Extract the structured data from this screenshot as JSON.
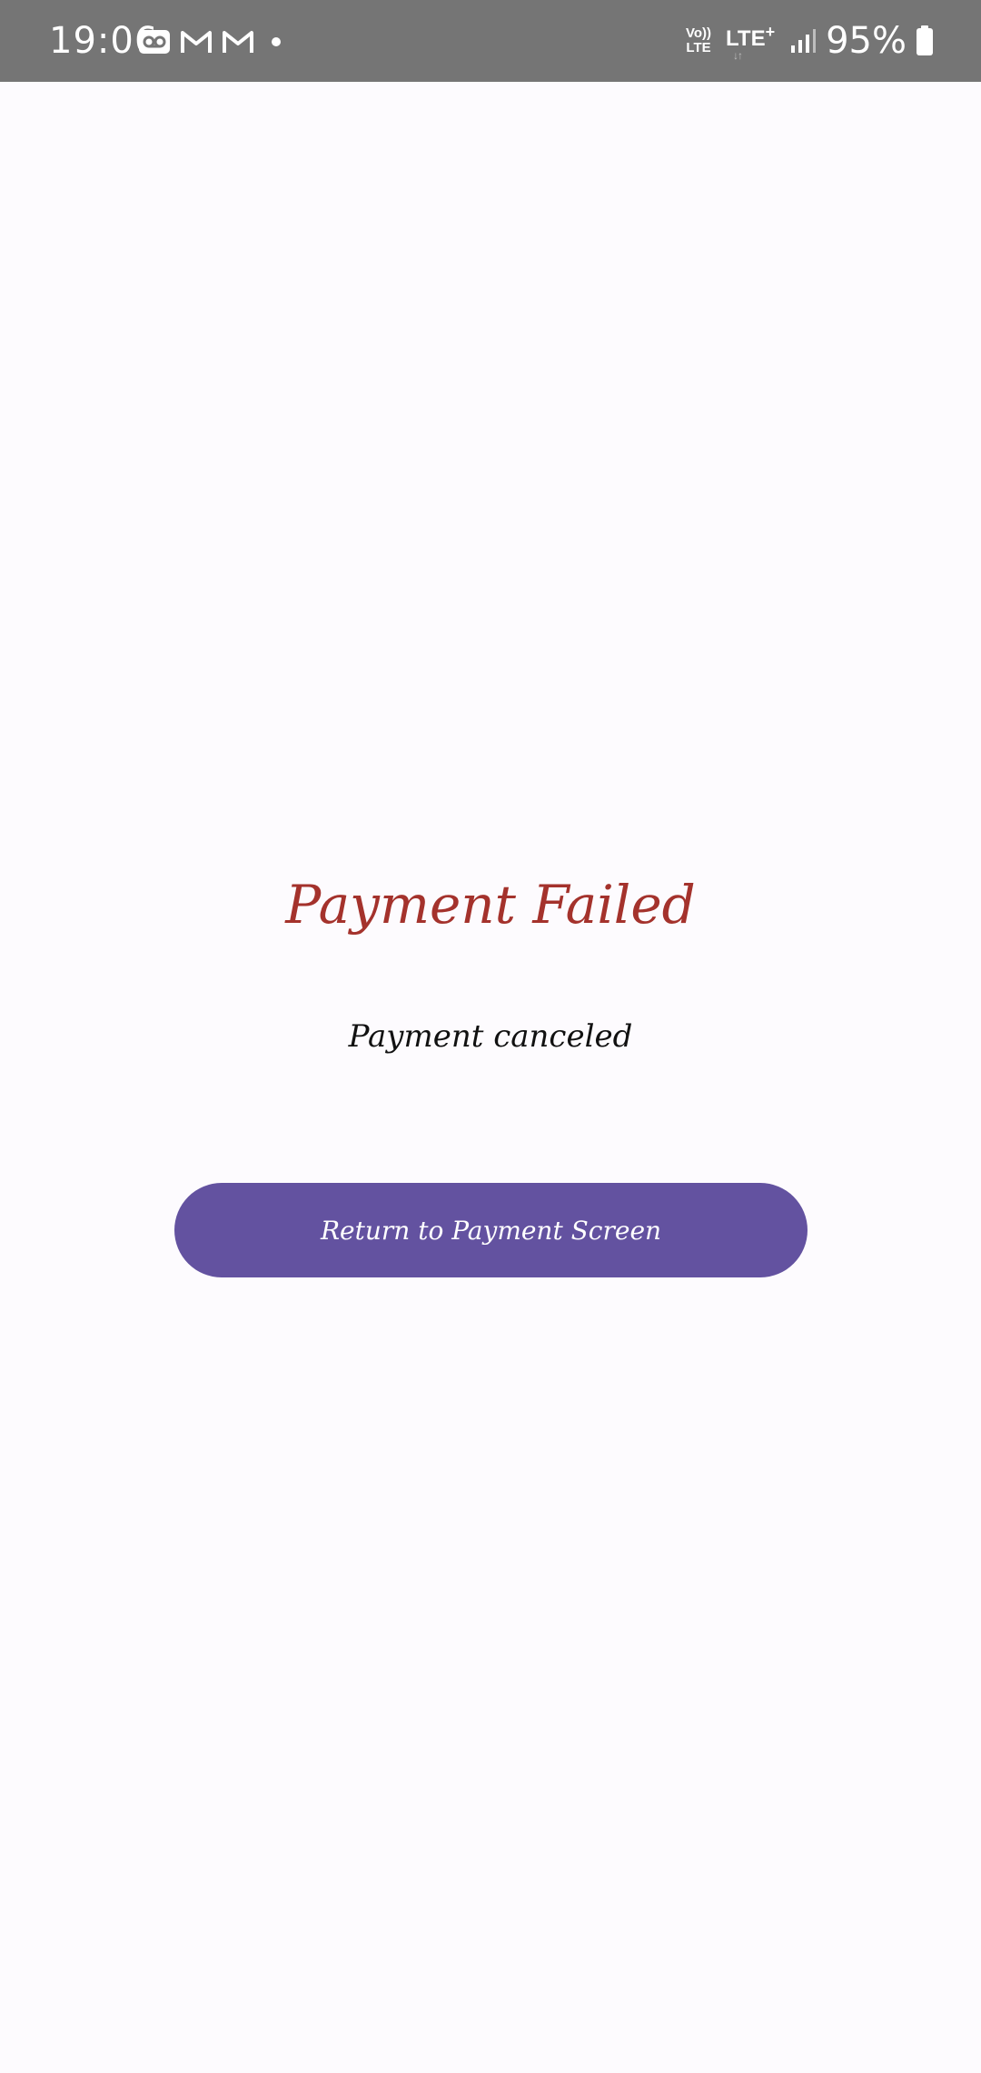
{
  "status_bar": {
    "time": "19:06",
    "battery_percent": "95%",
    "network_volte": "Vo)) LTE",
    "network_type": "LTE+",
    "signal_bars": 3,
    "battery_level": 0.95,
    "left_icons": [
      "voicemail-icon",
      "gmail-icon",
      "gmail-icon",
      "dot-icon"
    ],
    "right_icons": [
      "volte-icon",
      "lte-plus-icon",
      "signal-icon",
      "battery-icon"
    ]
  },
  "payment_result": {
    "title": "Payment Failed",
    "message": "Payment canceled",
    "return_button_label": "Return to Payment Screen"
  },
  "colors": {
    "status_bar_bg": "#757575",
    "page_bg": "#fdfbfe",
    "title_color": "#a4322c",
    "button_bg": "#6352a0",
    "button_text": "#ffffff"
  }
}
